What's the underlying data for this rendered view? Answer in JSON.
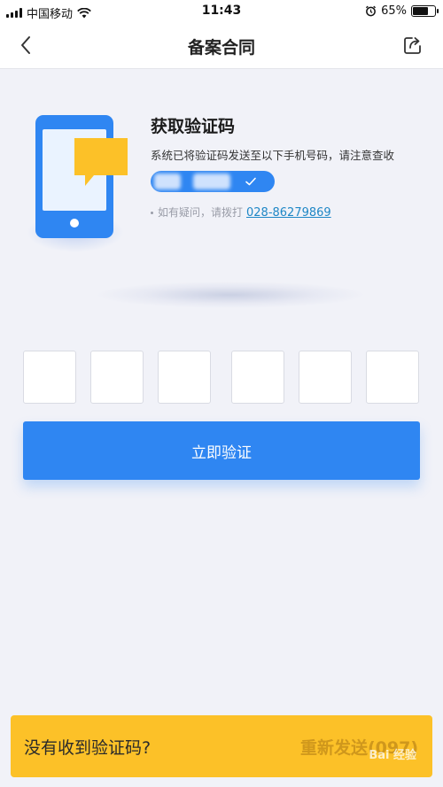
{
  "status_bar": {
    "carrier": "中国移动",
    "time": "11:43",
    "battery": "65%",
    "battery_level": 0.65
  },
  "nav": {
    "title": "备案合同"
  },
  "header": {
    "title": "获取验证码",
    "description": "系统已将验证码发送至以下手机号码，请注意查收",
    "help_text": "如有疑问，请拨打",
    "help_phone": "028-86279869"
  },
  "code_inputs": [
    "",
    "",
    "",
    "",
    "",
    ""
  ],
  "verify_button": {
    "label": "立即验证"
  },
  "bottom": {
    "prompt": "没有收到验证码?",
    "resend_label": "重新发送(097)",
    "watermark": "Bai 经验"
  },
  "colors": {
    "primary": "#2f86f2",
    "accent": "#fcc128",
    "background": "#f1f2f8"
  }
}
